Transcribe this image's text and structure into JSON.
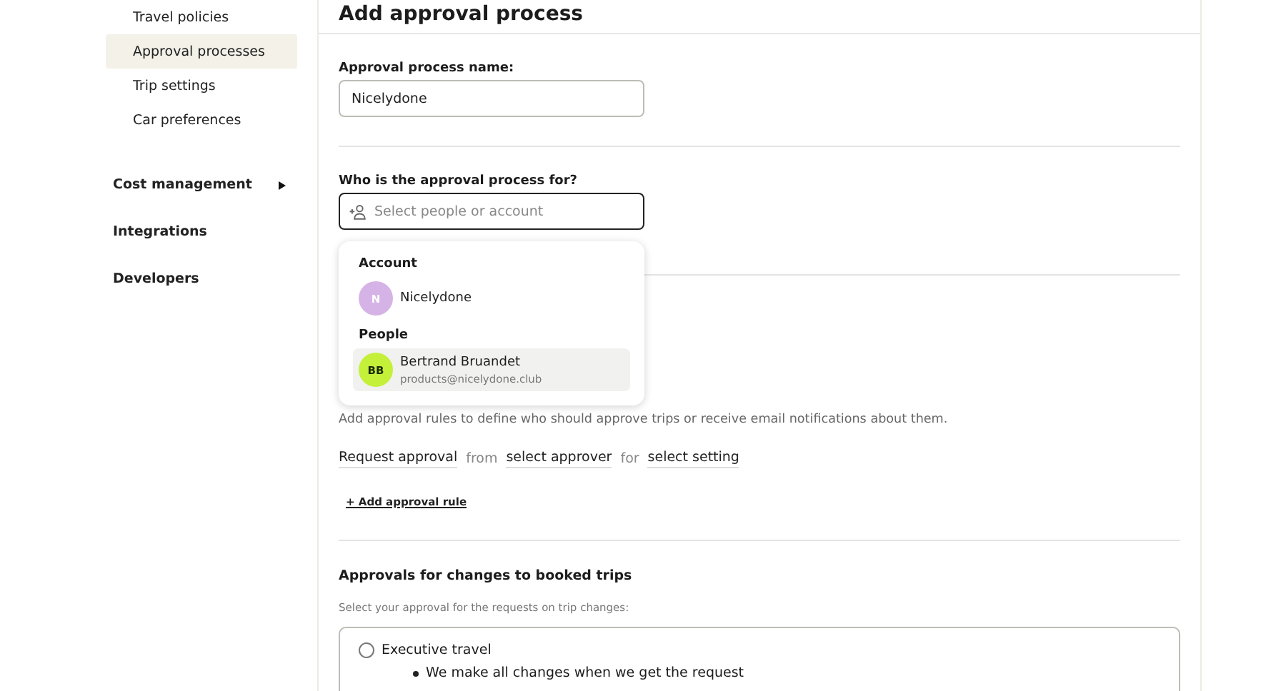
{
  "sidebar": {
    "items": [
      {
        "label": "Travel policies",
        "selected": false,
        "kind": "sub"
      },
      {
        "label": "Approval processes",
        "selected": true,
        "kind": "sub"
      },
      {
        "label": "Trip settings",
        "selected": false,
        "kind": "sub"
      },
      {
        "label": "Car preferences",
        "selected": false,
        "kind": "sub"
      },
      {
        "label": "Cost management",
        "selected": false,
        "kind": "group",
        "expandable": true
      },
      {
        "label": "Integrations",
        "selected": false,
        "kind": "group",
        "expandable": false
      },
      {
        "label": "Developers",
        "selected": false,
        "kind": "group",
        "expandable": false
      }
    ]
  },
  "page_title": "Add approval process",
  "name_field": {
    "label": "Approval process name:",
    "value": "Nicelydone"
  },
  "who_field": {
    "label": "Who is the approval process for?",
    "placeholder": "Select people or account"
  },
  "dropdown": {
    "groups": [
      {
        "heading": "Account",
        "options": [
          {
            "initials": "N",
            "name": "Nicelydone",
            "color": "#d6b3e6",
            "selected": false
          }
        ]
      },
      {
        "heading": "People",
        "options": [
          {
            "initials": "BB",
            "name": "Bertrand Bruandet",
            "email": "products@nicelydone.club",
            "color": "#c4f03a",
            "selected": true
          }
        ]
      }
    ]
  },
  "rules": {
    "description": "Add approval rules to define who should approve trips or receive email notifications about them.",
    "rule": [
      {
        "text": "Request approval",
        "kind": "pick"
      },
      {
        "text": "from",
        "kind": "joiner"
      },
      {
        "text": "select approver",
        "kind": "pick"
      },
      {
        "text": "for",
        "kind": "joiner"
      },
      {
        "text": "select setting",
        "kind": "pick"
      }
    ],
    "add_link": "+ Add approval rule"
  },
  "changes": {
    "heading": "Approvals for changes to booked trips",
    "subtitle": "Select your approval for the requests on trip changes:",
    "options": [
      {
        "label": "Executive travel",
        "selected": false,
        "bullets": [
          "We make all changes when we get the request"
        ]
      }
    ]
  }
}
